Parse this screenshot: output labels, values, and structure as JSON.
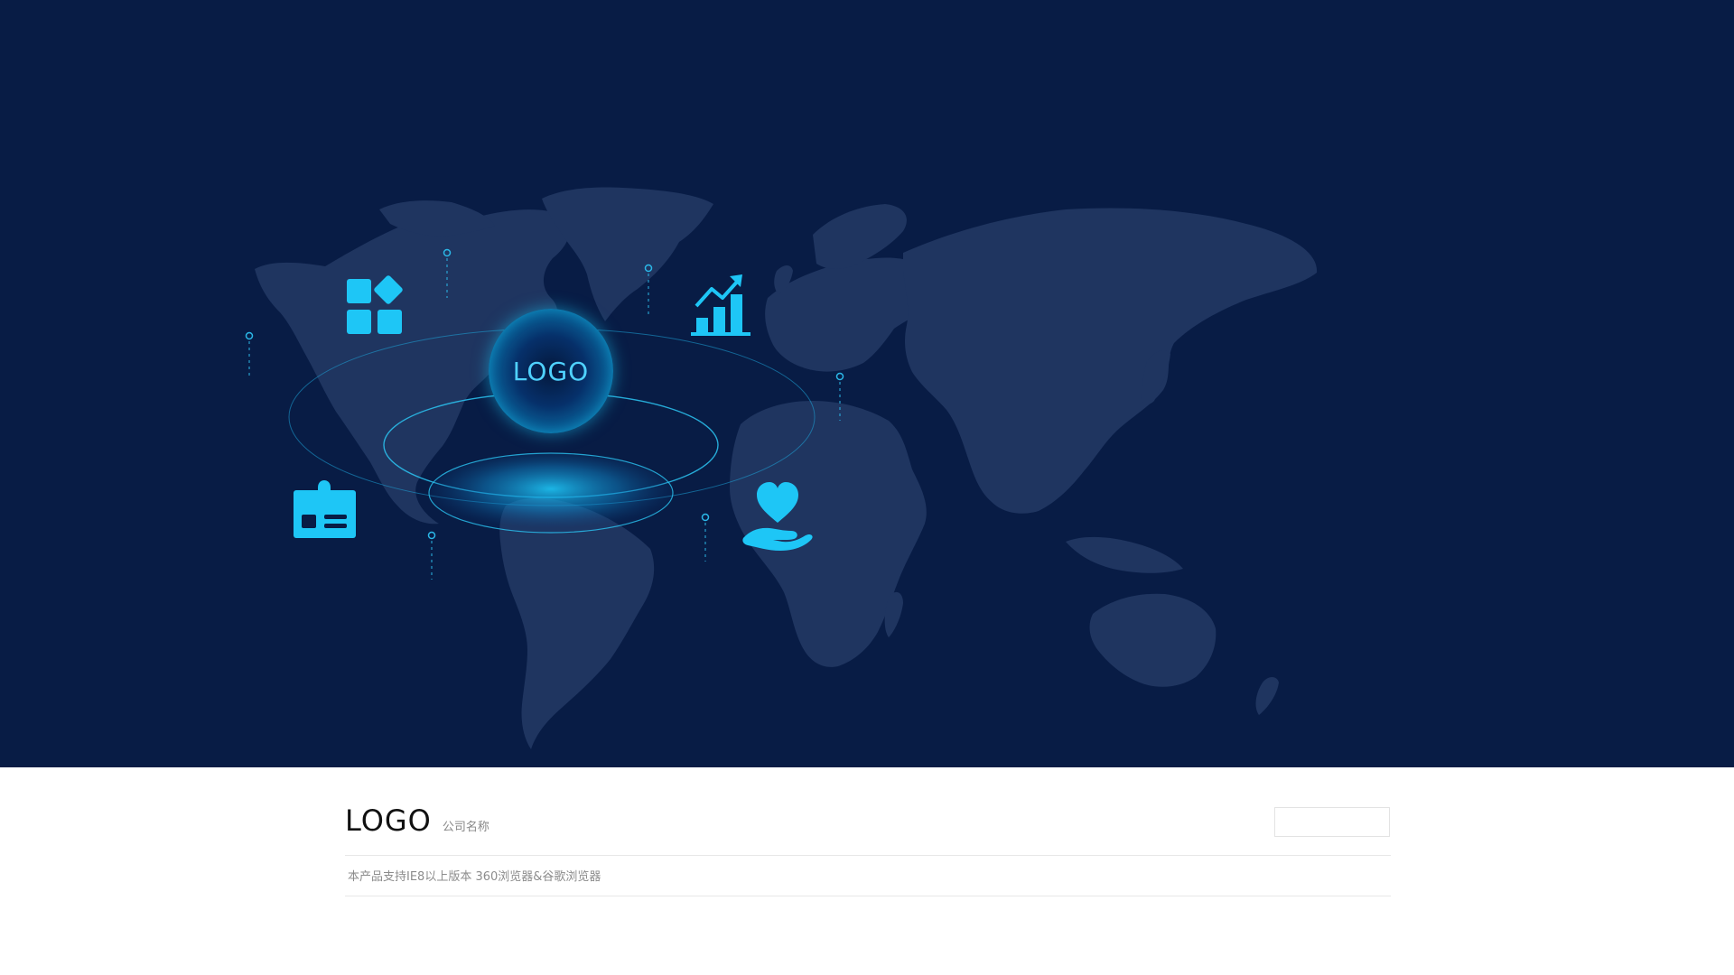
{
  "hero": {
    "orb_label": "LOGO",
    "colors": {
      "background": "#081c45",
      "continent": "#1f3560",
      "accent": "#19c4f1",
      "icon": "#1ec6f6"
    },
    "icons": [
      "apps-grid-icon",
      "growth-chart-icon",
      "id-card-icon",
      "heart-in-hand-icon"
    ]
  },
  "footer": {
    "logo_text": "LOGO",
    "company_name": "公司名称",
    "support_text": "本产品支持IE8以上版本 360浏览器&谷歌浏览器"
  }
}
